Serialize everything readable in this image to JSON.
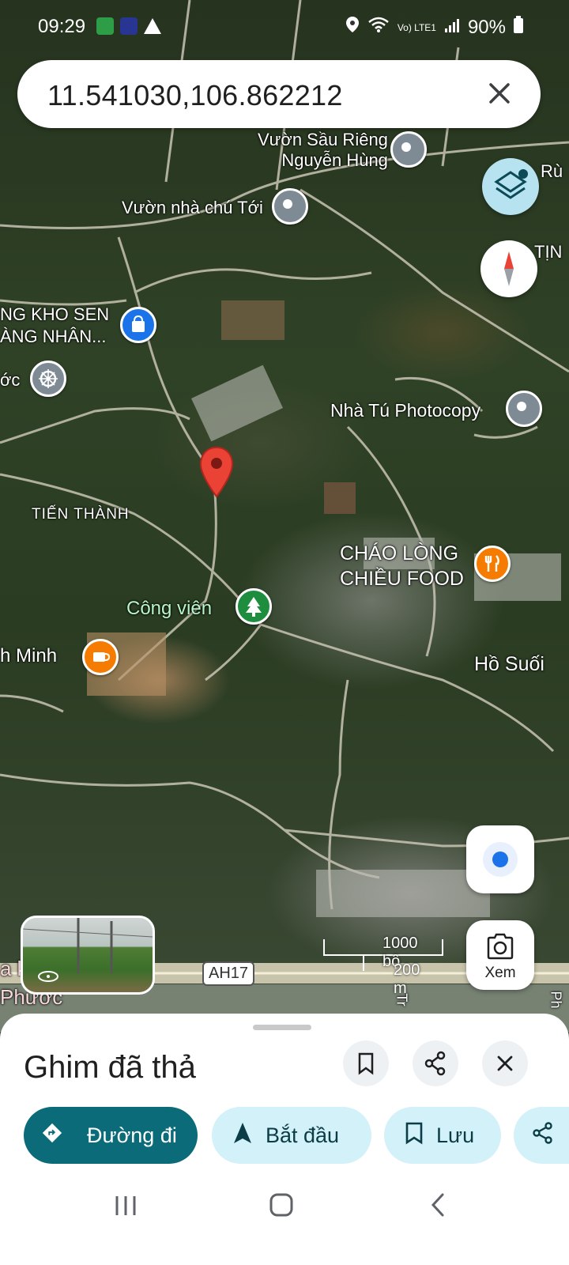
{
  "status_bar": {
    "time": "09:29",
    "battery": "90%",
    "network": "Vo) LTE1"
  },
  "search": {
    "query": "11.541030,106.862212"
  },
  "map": {
    "poi_labels": [
      {
        "name": "poi-vuon-sau-rieng",
        "line1": "Vườn Sầu Riêng",
        "line2": "Nguyễn Hùng",
        "icon": "pin-gray"
      },
      {
        "name": "poi-vuon-nha-chu-toi",
        "line1": "Vườn nhà chú Tới",
        "icon": "pin-gray"
      },
      {
        "name": "poi-kho-sen",
        "line1": "NG KHO SEN",
        "line2": "ÀNG NHÂN...",
        "icon": "shopping-bag-icon"
      },
      {
        "name": "poi-phuoc",
        "line1": "ớc",
        "icon": "dharma-wheel-icon"
      },
      {
        "name": "poi-nha-tu-photocopy",
        "line1": "Nhà Tú Photocopy",
        "icon": "pin-gray"
      },
      {
        "name": "poi-chao-long",
        "line1": "CHÁO LÒNG",
        "line2": "CHIỀU FOOD",
        "icon": "restaurant-icon"
      },
      {
        "name": "poi-cong-vien",
        "line1": "Công viên",
        "icon": "tree-icon"
      },
      {
        "name": "poi-minh",
        "line1": "h Minh",
        "icon": "cafe-icon"
      }
    ],
    "area_labels": {
      "tien_thanh": "TIẾN THÀNH",
      "ho_suoi": "Hồ Suối",
      "ru": "Rù",
      "tin": "TỊN",
      "phuoc": "Phước",
      "ak": "a k",
      "tr": "Tr",
      "ph": "Ph"
    },
    "road_shield": "AH17",
    "scale": {
      "imperial": "1000 bộ",
      "metric": "200 m"
    },
    "colors": {
      "dropped_pin": "#ea4335",
      "layers_button": "#b6e3ef",
      "location_dot": "#1a73e8"
    }
  },
  "controls": {
    "xem_label": "Xem"
  },
  "sheet": {
    "title": "Ghim đã thả",
    "chips": [
      {
        "label": "Đường đi",
        "icon": "directions-icon"
      },
      {
        "label": "Bắt đầu",
        "icon": "navigation-arrow-icon"
      },
      {
        "label": "Lưu",
        "icon": "bookmark-icon"
      }
    ],
    "colors": {
      "primary_chip": "#0b6b78",
      "secondary_chip": "#d3f1f8"
    }
  }
}
